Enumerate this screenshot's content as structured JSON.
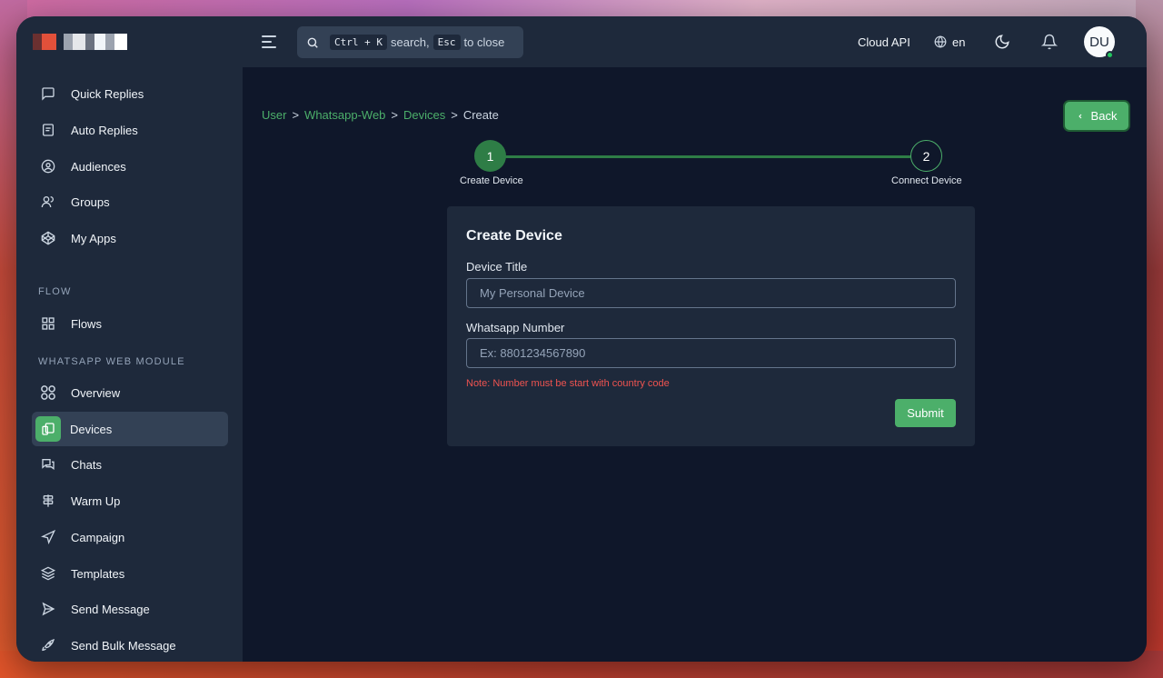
{
  "header": {
    "search": {
      "kbd1": "Ctrl + K",
      "text1": "search,",
      "kbd2": "Esc",
      "text2": "to close"
    },
    "cloud_api_label": "Cloud API",
    "language": "en",
    "avatar_initials": "DU"
  },
  "sidebar": {
    "top_items": [
      {
        "label": "Quick Replies",
        "icon": "message-square-icon"
      },
      {
        "label": "Auto Replies",
        "icon": "file-text-icon"
      },
      {
        "label": "Audiences",
        "icon": "user-circle-icon"
      },
      {
        "label": "Groups",
        "icon": "users-icon"
      },
      {
        "label": "My Apps",
        "icon": "codepen-icon"
      }
    ],
    "flow_heading": "FLOW",
    "flow_items": [
      {
        "label": "Flows",
        "icon": "grid-icon"
      }
    ],
    "wa_heading": "WHATSAPP WEB MODULE",
    "wa_items": [
      {
        "label": "Overview",
        "icon": "circles-icon"
      },
      {
        "label": "Devices",
        "icon": "devices-icon"
      },
      {
        "label": "Chats",
        "icon": "chat-bubbles-icon"
      },
      {
        "label": "Warm Up",
        "icon": "signpost-icon"
      },
      {
        "label": "Campaign",
        "icon": "navigation-icon"
      },
      {
        "label": "Templates",
        "icon": "layers-icon"
      },
      {
        "label": "Send Message",
        "icon": "send-icon"
      },
      {
        "label": "Send Bulk Message",
        "icon": "rocket-icon"
      }
    ]
  },
  "breadcrumb": {
    "items": [
      "User",
      "Whatsapp-Web",
      "Devices",
      "Create"
    ],
    "separator": ">"
  },
  "back_label": "Back",
  "stepper": {
    "step1_number": "1",
    "step1_label": "Create Device",
    "step2_number": "2",
    "step2_label": "Connect Device"
  },
  "form": {
    "title": "Create Device",
    "device_title_label": "Device Title",
    "device_title_placeholder": "My Personal Device",
    "whatsapp_number_label": "Whatsapp Number",
    "whatsapp_number_placeholder": "Ex: 8801234567890",
    "note": "Note: Number must be start with country code",
    "submit_label": "Submit"
  },
  "colors": {
    "accent": "#4caf6a",
    "sidebar_bg": "#1e293b",
    "main_bg": "#0f172a",
    "error": "#ef5350"
  }
}
